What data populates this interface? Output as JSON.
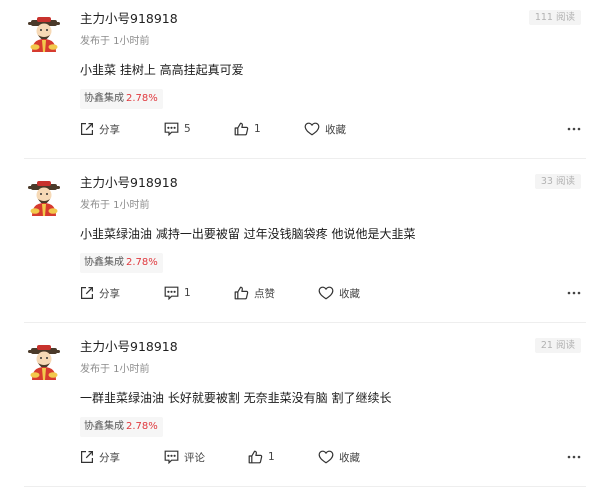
{
  "posts": [
    {
      "author": "主力小号918918",
      "time": "发布于 1小时前",
      "reads": "111 阅读",
      "content": "小韭菜 挂树上 高高挂起真可爱",
      "stock_name": "协鑫集成",
      "stock_change": "2.78%",
      "share_label": "分享",
      "comment_label": "5",
      "like_label": "1",
      "collect_label": "收藏"
    },
    {
      "author": "主力小号918918",
      "time": "发布于 1小时前",
      "reads": "33 阅读",
      "content": "小韭菜绿油油 减持一出要被留 过年没钱脑袋疼 他说他是大韭菜",
      "stock_name": "协鑫集成",
      "stock_change": "2.78%",
      "share_label": "分享",
      "comment_label": "1",
      "like_label": "点赞",
      "collect_label": "收藏"
    },
    {
      "author": "主力小号918918",
      "time": "发布于 1小时前",
      "reads": "21 阅读",
      "content": "一群韭菜绿油油 长好就要被割 无奈韭菜没有脑 割了继续长",
      "stock_name": "协鑫集成",
      "stock_change": "2.78%",
      "share_label": "分享",
      "comment_label": "评论",
      "like_label": "1",
      "collect_label": "收藏"
    }
  ],
  "colors": {
    "stock_up": "#e0393e",
    "reads_text": "#b2b2b2",
    "divider": "#eeeeee"
  },
  "icons": [
    "avatar-caishen",
    "share-icon",
    "comment-icon",
    "like-icon",
    "collect-icon",
    "more-icon"
  ]
}
